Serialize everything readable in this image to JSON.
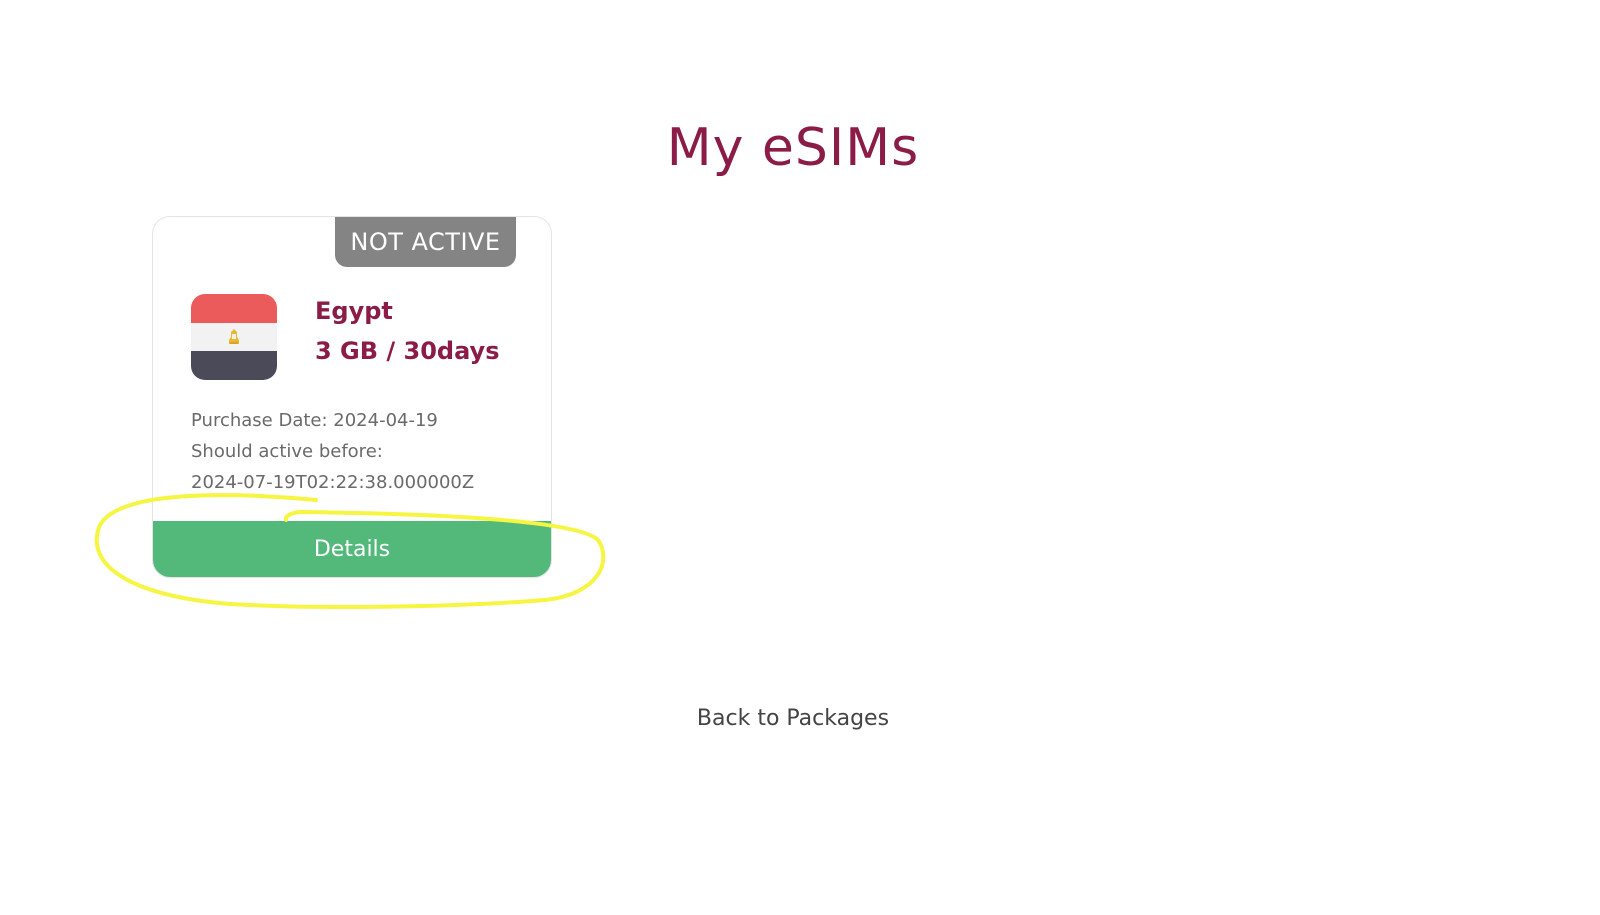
{
  "page": {
    "title": "My eSIMs",
    "back_link": "Back to Packages"
  },
  "esims": [
    {
      "status": "NOT ACTIVE",
      "country": "Egypt",
      "plan": "3 GB / 30days",
      "purchase_date_text": "Purchase Date: 2024-04-19",
      "activate_before_label": "Should active before:",
      "activate_before_value": "2024-07-19T02:22:38.000000Z",
      "details_button": "Details",
      "flag_icon": "egypt-flag-icon"
    }
  ],
  "colors": {
    "brand": "#8b1c47",
    "status_badge": "#848484",
    "details_button": "#52b97a",
    "highlight_annotation": "#f5f542"
  }
}
